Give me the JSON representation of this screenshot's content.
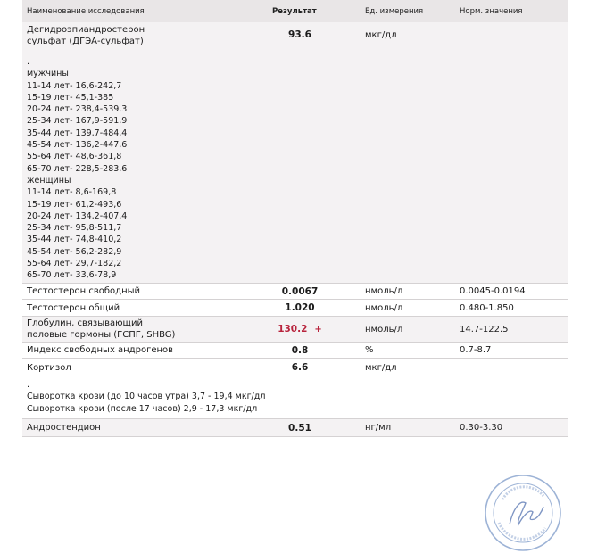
{
  "header": {
    "name": "Наименование исследования",
    "result": "Результат",
    "unit": "Ед. измерения",
    "norm": "Норм. значения"
  },
  "dhea": {
    "name_line1": "Дегидроэпиандростерон",
    "name_line2": "сульфат (ДГЭА-сульфат)",
    "result": "93.6",
    "unit": "мкг/дл",
    "ref_lines": [
      ".",
      "мужчины",
      "11-14 лет- 16,6-242,7",
      "15-19 лет- 45,1-385",
      "20-24 лет- 238,4-539,3",
      "25-34 лет- 167,9-591,9",
      "35-44 лет- 139,7-484,4",
      "45-54 лет- 136,2-447,6",
      "55-64 лет- 48,6-361,8",
      "65-70 лет- 228,5-283,6",
      "женщины",
      "11-14 лет- 8,6-169,8",
      "15-19 лет- 61,2-493,6",
      "20-24 лет- 134,2-407,4",
      "25-34 лет- 95,8-511,7",
      "35-44 лет- 74,8-410,2",
      "45-54 лет- 56,2-282,9",
      "55-64 лет- 29,7-182,2",
      "65-70 лет- 33,6-78,9"
    ]
  },
  "free_testosterone": {
    "name": "Тестостерон свободный",
    "result": "0.0067",
    "unit": "нмоль/л",
    "norm": "0.0045-0.0194"
  },
  "total_testosterone": {
    "name": "Тестостерон общий",
    "result": "1.020",
    "unit": "нмоль/л",
    "norm": "0.480-1.850"
  },
  "shbg": {
    "name_line1": "Глобулин, связывающий",
    "name_line2": "половые гормоны (ГСПГ, SHBG)",
    "result": "130.2",
    "flag": "+",
    "unit": "нмоль/л",
    "norm": "14.7-122.5",
    "flag_color": "#b8233c"
  },
  "fai": {
    "name": "Индекс свободных андрогенов",
    "result": "0.8",
    "unit": "%",
    "norm": "0.7-8.7"
  },
  "cortisol": {
    "name": "Кортизол",
    "result": "6.6",
    "unit": "мкг/дл",
    "ref_lines": [
      ".",
      "Сыворотка крови (до 10 часов утра) 3,7 - 19,4 мкг/дл",
      "Сыворотка крови (после 17 часов) 2,9 - 17,3 мкг/дл"
    ]
  },
  "androstenedione": {
    "name": "Андростендион",
    "result": "0.51",
    "unit": "нг/мл",
    "norm": "0.30-3.30"
  },
  "colors": {
    "header_bg": "#e9e6e7",
    "row_line": "#d5d2d3",
    "stamp": "#9db3d6"
  }
}
